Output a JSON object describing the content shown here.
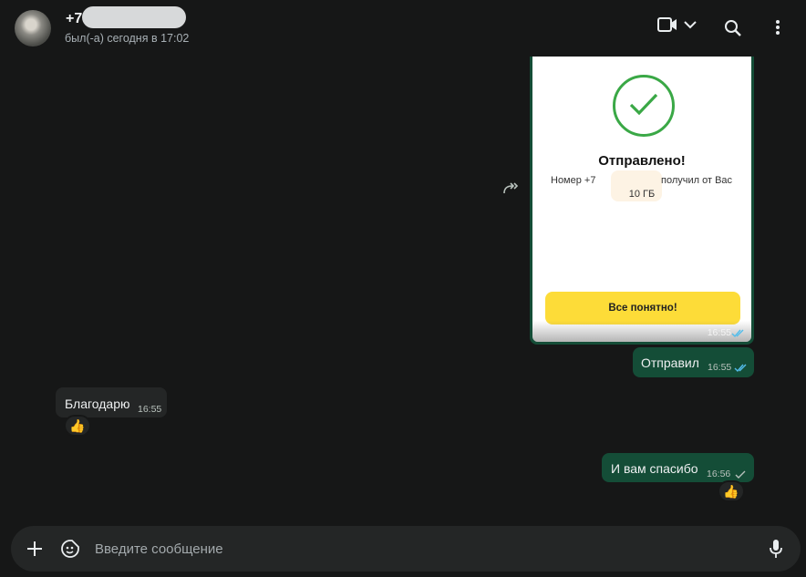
{
  "header": {
    "contact_name": "+7",
    "status": "был(-а) сегодня в 17:02",
    "icons": [
      "video-call-icon",
      "chevron-down-icon",
      "search-icon",
      "more-options-icon"
    ]
  },
  "messages": [
    {
      "type": "image",
      "direction": "outgoing",
      "forwarded": true,
      "card": {
        "title": "Отправлено!",
        "line1_prefix": "Номер +7",
        "line1_suffix": "получил от Вас",
        "line2": "10 ГБ",
        "button_label": "Все понятно!"
      },
      "time": "16:55",
      "status": "read"
    },
    {
      "type": "text",
      "direction": "outgoing",
      "text": "Отправил",
      "time": "16:55",
      "status": "read"
    },
    {
      "type": "text",
      "direction": "incoming",
      "text": "Благодарю",
      "time": "16:55",
      "reaction": "👍"
    },
    {
      "type": "text",
      "direction": "outgoing",
      "text": "И вам спасибо",
      "time": "16:56",
      "status": "sent",
      "reaction": "👍"
    }
  ],
  "composer": {
    "placeholder": "Введите сообщение",
    "icons": [
      "plus-icon",
      "sticker-icon",
      "microphone-icon"
    ]
  },
  "colors": {
    "background": "#161717",
    "outgoing_bubble": "#144d37",
    "incoming_bubble": "#242626",
    "read_tick": "#53bdeb",
    "accent_yellow": "#fddc38",
    "success_green": "#3aa846"
  }
}
